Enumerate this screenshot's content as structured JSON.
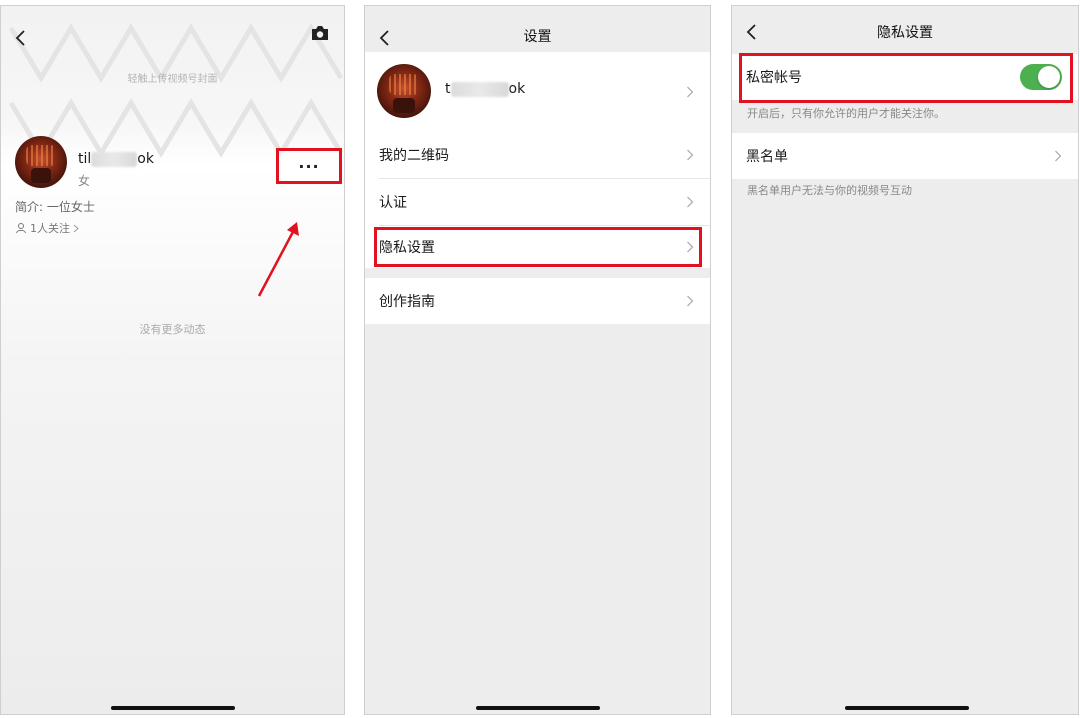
{
  "screen1": {
    "cover_hint": "轻触上传视频号封面",
    "name_prefix": "til",
    "name_suffix": "ok",
    "gender": "女",
    "bio": "简介: 一位女士",
    "follow": "1人关注",
    "more_label": "···",
    "empty_text": "没有更多动态"
  },
  "screen2": {
    "title": "设置",
    "profile_name_prefix": "t",
    "profile_name_suffix": "ok",
    "items": [
      {
        "label": "我的二维码"
      },
      {
        "label": "认证"
      },
      {
        "label": "隐私设置"
      },
      {
        "label": "创作指南"
      }
    ]
  },
  "screen3": {
    "title": "隐私设置",
    "private_account": {
      "label": "私密帐号",
      "enabled": true,
      "hint": "开启后，只有你允许的用户才能关注你。"
    },
    "blacklist": {
      "label": "黑名单",
      "hint": "黑名单用户无法与你的视频号互动"
    }
  },
  "colors": {
    "highlight": "#e0121f",
    "toggle_on": "#4cb050",
    "background": "#ededed"
  }
}
